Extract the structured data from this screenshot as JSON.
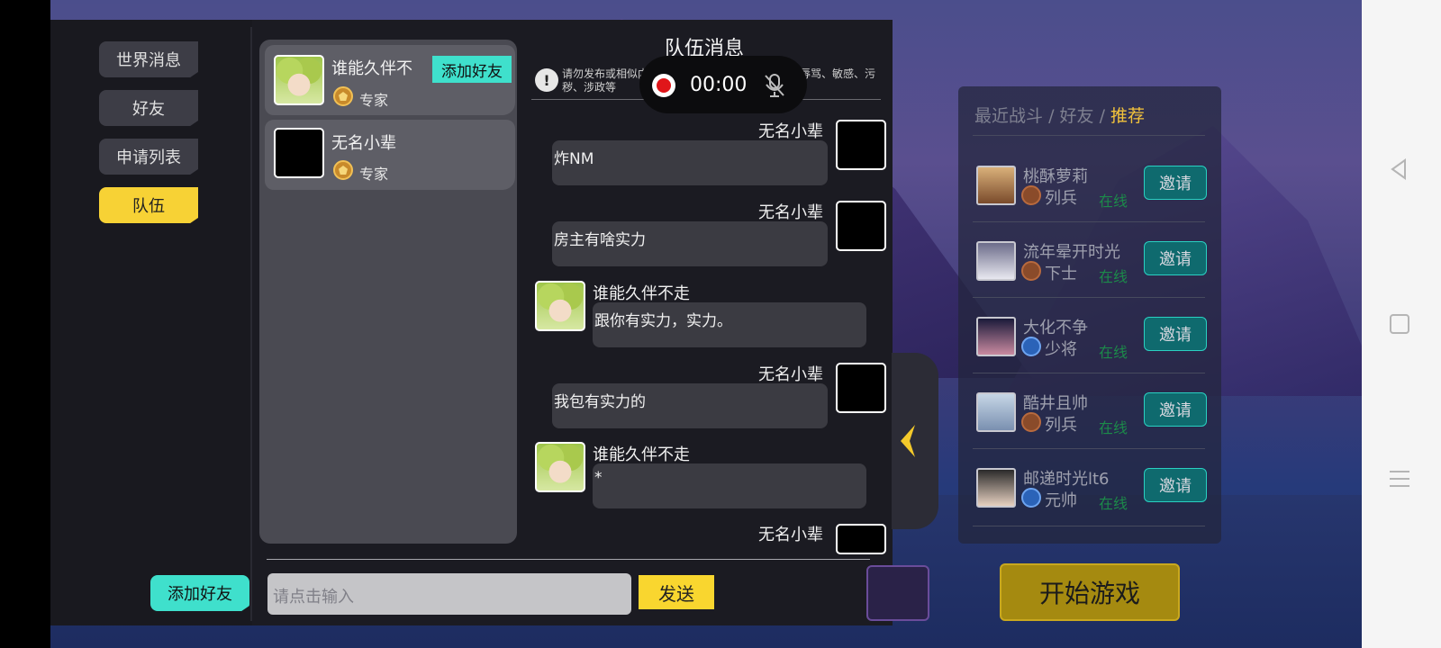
{
  "tabs": {
    "world": "世界消息",
    "friends": "好友",
    "requests": "申请列表",
    "team": "队伍"
  },
  "friend_list": [
    {
      "name": "谁能久伴不",
      "rank": "专家",
      "avatar": "anime",
      "action": "添加好友"
    },
    {
      "name": "无名小辈",
      "rank": "专家",
      "avatar": "black"
    }
  ],
  "chat": {
    "title": "队伍消息",
    "warning_icon": "!",
    "warning": "请勿发布或相似内容，关于：账号、充值、返利、辱骂、敏感、污秽、涉政等",
    "recording": {
      "time": "00:00"
    },
    "messages": [
      {
        "sender": "无名小辈",
        "text": "炸NM",
        "side": "right"
      },
      {
        "sender": "无名小辈",
        "text": "房主有啥实力",
        "side": "right"
      },
      {
        "sender": "谁能久伴不走",
        "text": "跟你有实力，实力。",
        "side": "left"
      },
      {
        "sender": "无名小辈",
        "text": "我包有实力的",
        "side": "right"
      },
      {
        "sender": "谁能久伴不走",
        "text": "*",
        "side": "left"
      },
      {
        "sender": "无名小辈",
        "text": "",
        "side": "right"
      }
    ],
    "input_placeholder": "请点击输入",
    "send_label": "发送"
  },
  "bottom_add_friend": "添加好友",
  "recommend": {
    "tabs": [
      "最近战斗",
      "好友",
      "推荐"
    ],
    "separator": "/",
    "active_tab": "推荐",
    "players": [
      {
        "name": "桃酥萝莉",
        "rank": "列兵",
        "status": "在线",
        "invite": "邀请"
      },
      {
        "name": "流年晕开时光",
        "rank": "下士",
        "status": "在线",
        "invite": "邀请"
      },
      {
        "name": "大化不争",
        "rank": "少将",
        "status": "在线",
        "invite": "邀请"
      },
      {
        "name": "酷井且帅",
        "rank": "列兵",
        "status": "在线",
        "invite": "邀请"
      },
      {
        "name": "邮递时光lt6",
        "rank": "元帅",
        "status": "在线",
        "invite": "邀请"
      }
    ]
  },
  "start_game": "开始游戏",
  "colors": {
    "accent_yellow": "#f7d235",
    "accent_cyan": "#3fe0cc",
    "panel": "#1b1b22"
  }
}
